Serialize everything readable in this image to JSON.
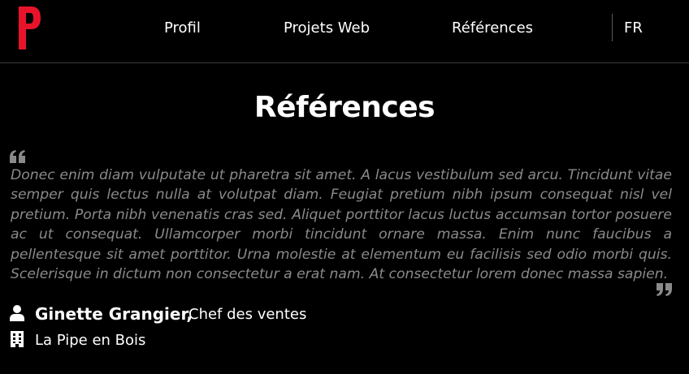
{
  "brand": {
    "logo_icon": "p-logo-icon",
    "accent_color": "#e8132a"
  },
  "nav": {
    "items": [
      {
        "label": "Profil"
      },
      {
        "label": "Projets Web"
      },
      {
        "label": "Références"
      }
    ],
    "language": "FR"
  },
  "page": {
    "title": "Références"
  },
  "testimonial": {
    "quote": "Donec enim diam vulputate ut pharetra sit amet. A lacus vestibulum sed arcu. Tincidunt vitae semper quis lectus nulla at volutpat diam. Feugiat pretium nibh ipsum consequat nisl vel pretium. Porta nibh venenatis cras sed. Aliquet porttitor lacus luctus accumsan tortor posuere ac ut consequat. Ullamcorper morbi tincidunt ornare massa. Enim nunc faucibus a pellentesque sit amet porttitor. Urna molestie at elementum eu facilisis sed odio morbi quis. Scelerisque in dictum non consectetur a erat nam. At consectetur lorem donec massa sapien.",
    "author_name": "Ginette Grangier,",
    "author_role": "Chef des ventes",
    "company": "La Pipe en Bois",
    "icons": {
      "open_quote": "quote-open-icon",
      "close_quote": "quote-close-icon",
      "author": "user-icon",
      "company": "building-icon"
    },
    "quote_color": "#8a8a8a"
  }
}
